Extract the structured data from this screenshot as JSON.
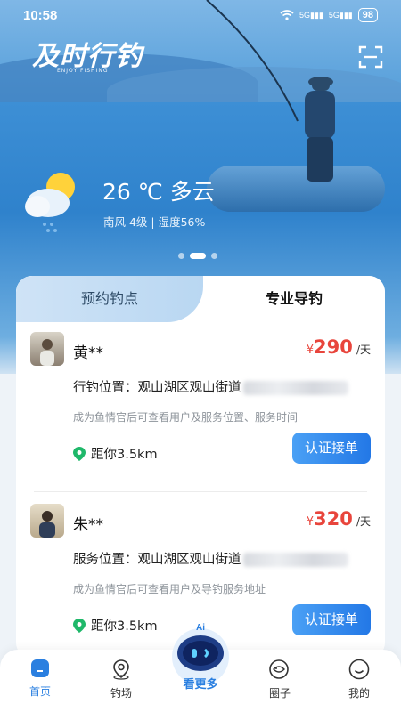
{
  "status_bar": {
    "time": "10:58",
    "network": "5G",
    "battery": "98"
  },
  "header": {
    "logo_text": "及时行钓",
    "logo_subtitle": "ENJOY FISHING"
  },
  "weather": {
    "temperature": "26 ℃ 多云",
    "details": "南风 4级 | 湿度56%"
  },
  "carousel": {
    "count": 3,
    "active_index": 1
  },
  "tabs": [
    {
      "label": "预约钓点",
      "active": false
    },
    {
      "label": "专业导钓",
      "active": true
    }
  ],
  "guides": [
    {
      "name": "黄**",
      "price_symbol": "¥",
      "price": "290",
      "price_unit": "/天",
      "location_label": "行钓位置：观山湖区观山街道",
      "hint": "成为鱼情官后可查看用户及服务位置、服务时间",
      "distance": "距你3.5km",
      "button": "认证接单"
    },
    {
      "name": "朱**",
      "price_symbol": "¥",
      "price": "320",
      "price_unit": "/天",
      "location_label": "服务位置：观山湖区观山街道",
      "hint": "成为鱼情官后可查看用户及导钓服务地址",
      "distance": "距你3.5km",
      "button": "认证接单"
    }
  ],
  "bottom_nav": {
    "items": [
      {
        "label": "首页",
        "active": true
      },
      {
        "label": "钓场"
      },
      {
        "label": "圈子"
      },
      {
        "label": "我的"
      }
    ],
    "ai_badge": "Ai",
    "ai_label": "看更多"
  },
  "colors": {
    "accent": "#2a7fe0",
    "price": "#e8453c"
  }
}
